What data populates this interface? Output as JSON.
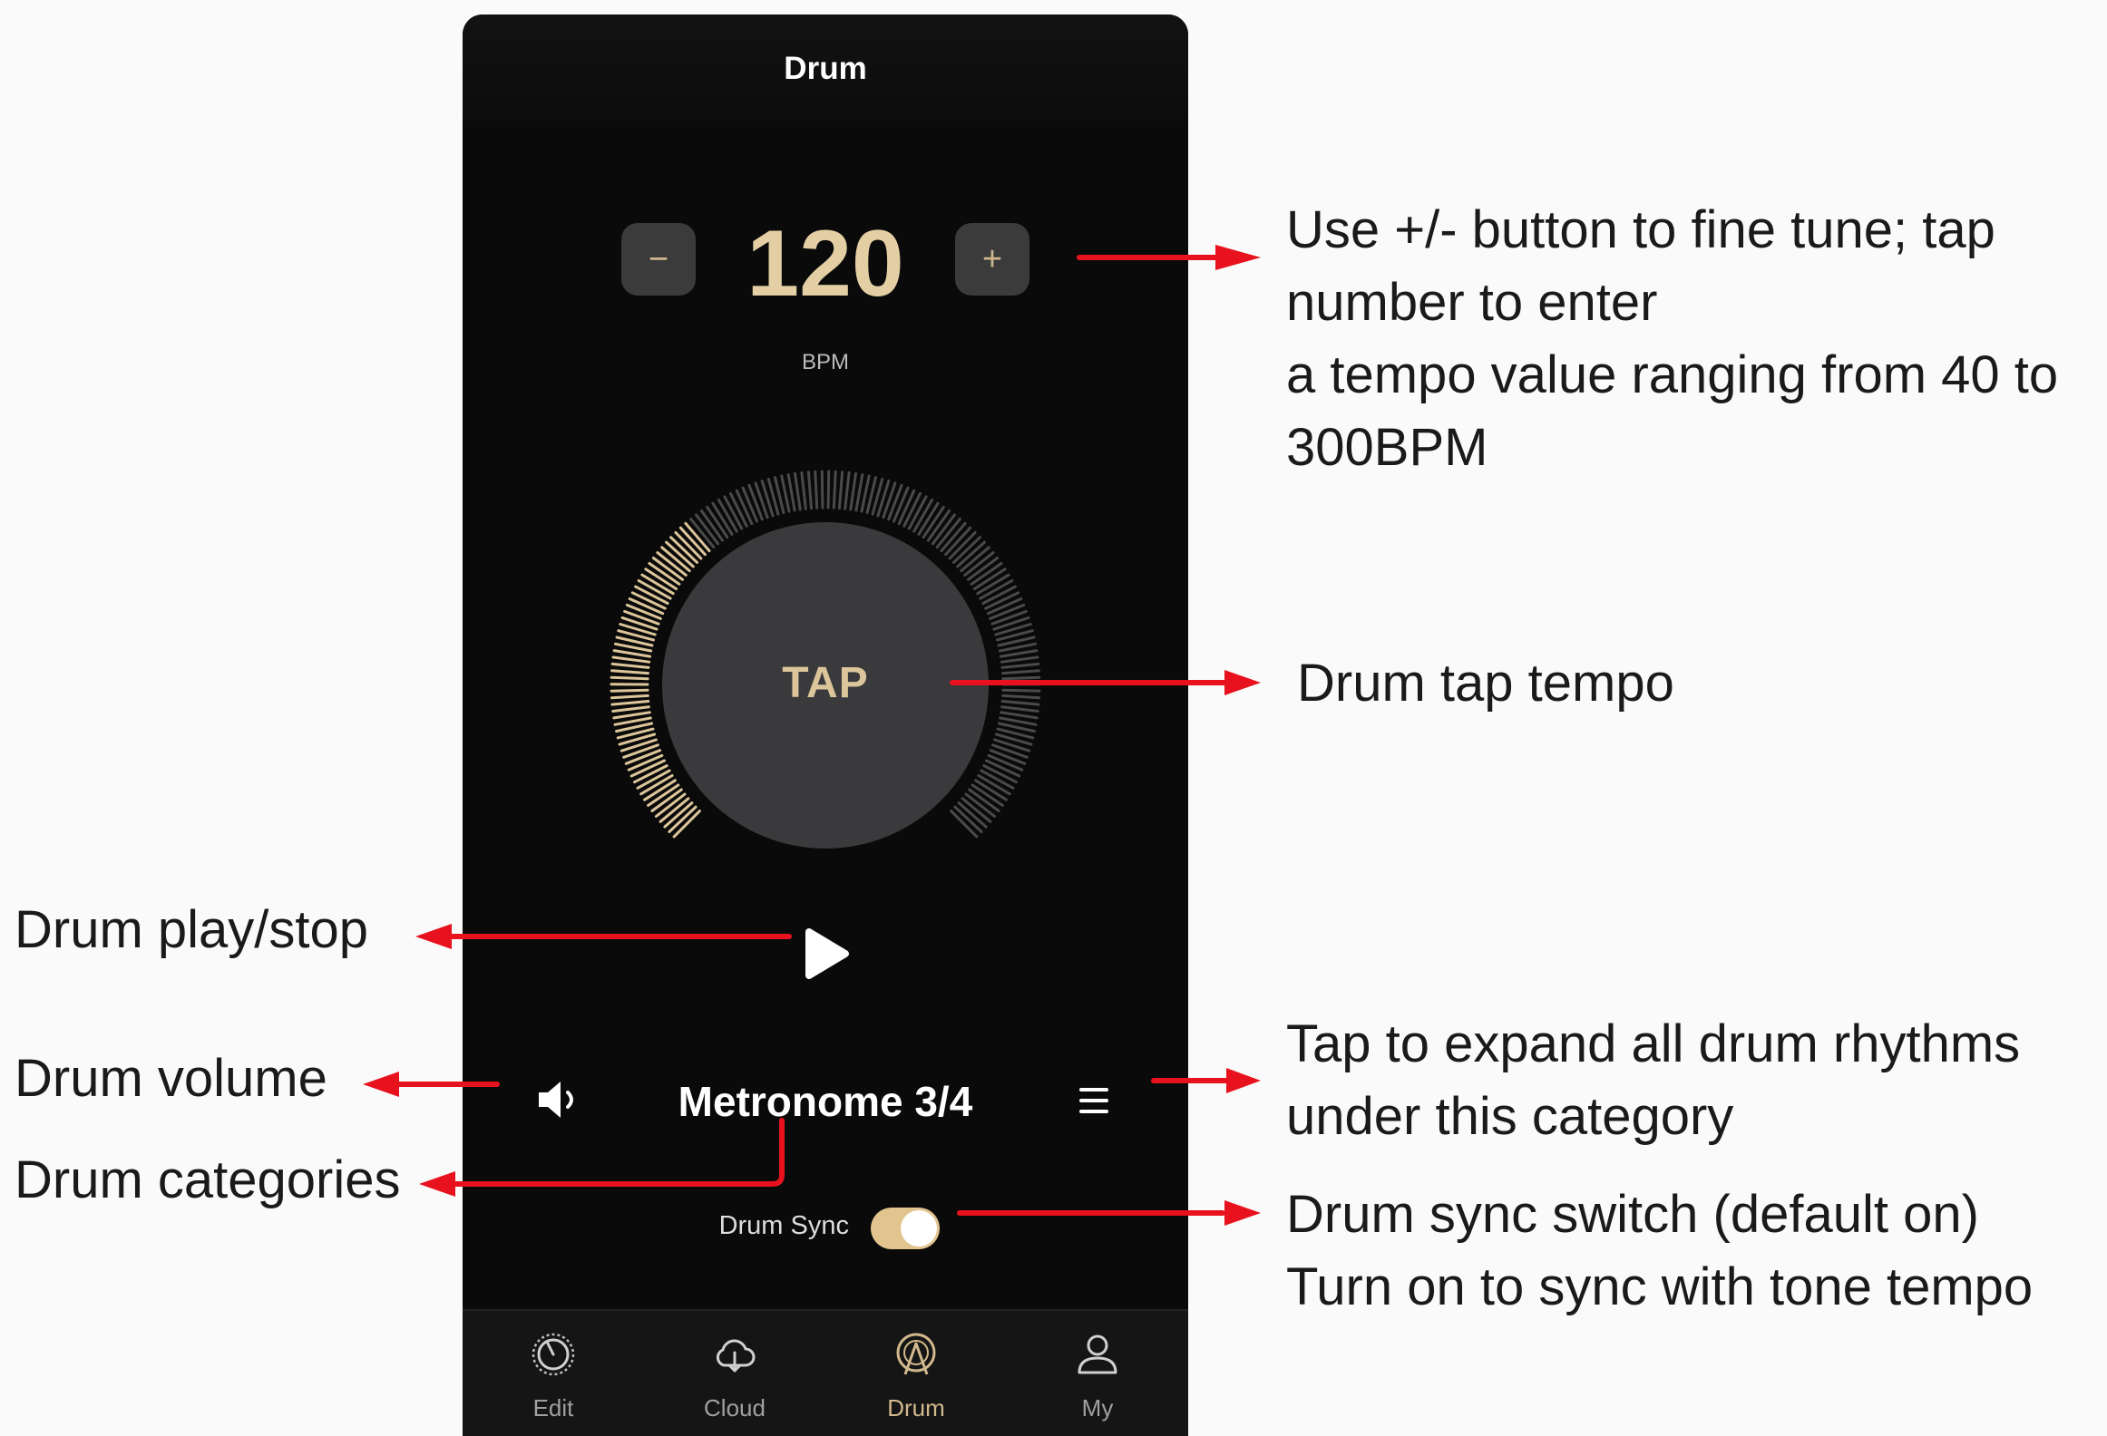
{
  "app": {
    "title": "Drum",
    "tempo": {
      "decrease_label": "−",
      "increase_label": "+",
      "value": "120",
      "unit": "BPM"
    },
    "tap_label": "TAP",
    "beat_ring_progress": 0.35,
    "rhythm_name": "Metronome 3/4",
    "drum_sync": {
      "label": "Drum Sync",
      "on": true
    },
    "tabs": [
      {
        "label": "Edit",
        "icon": "knob-icon"
      },
      {
        "label": "Cloud",
        "icon": "cloud-icon"
      },
      {
        "label": "Drum",
        "icon": "drum-icon",
        "active": true
      },
      {
        "label": "My",
        "icon": "user-icon"
      }
    ],
    "colors": {
      "accent": "#dcc59a",
      "background": "#0a0a0a",
      "arrow": "#e8121e"
    }
  },
  "annotations": {
    "tempo_note": [
      "Use +/- button to fine tune; tap",
      "number to enter",
      "a tempo value ranging from 40 to",
      "300BPM"
    ],
    "tap_note": "Drum tap tempo",
    "play_note": "Drum play/stop",
    "volume_note": "Drum volume",
    "categories_note": "Drum categories",
    "list_note": [
      "Tap to expand all drum rhythms",
      "under this category"
    ],
    "sync_note": [
      "Drum sync switch (default on)",
      "Turn on to sync with tone tempo"
    ]
  }
}
